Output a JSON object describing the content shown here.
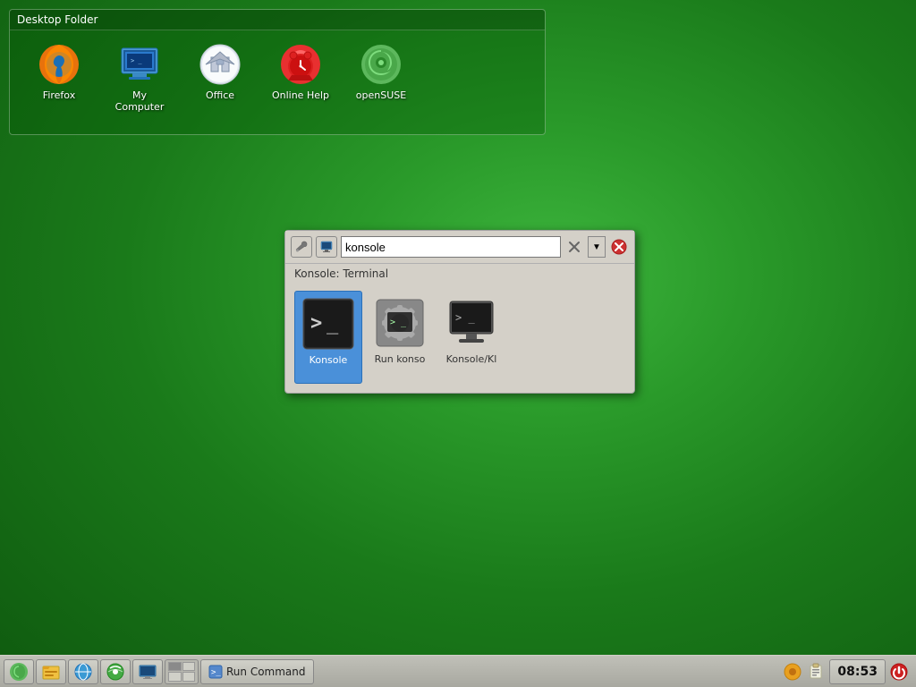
{
  "desktop": {
    "title": "Desktop Folder",
    "background_color": "#1a7a1a",
    "icons": [
      {
        "id": "firefox",
        "label": "Firefox",
        "type": "firefox"
      },
      {
        "id": "mycomputer",
        "label": "My Computer",
        "type": "mycomputer"
      },
      {
        "id": "office",
        "label": "Office",
        "type": "office"
      },
      {
        "id": "onlinehelp",
        "label": "Online Help",
        "type": "onlinehelp"
      },
      {
        "id": "opensuse",
        "label": "openSUSE",
        "type": "opensuse"
      }
    ]
  },
  "run_dialog": {
    "search_value": "konsole",
    "search_placeholder": "konsole",
    "result_label": "Konsole: Terminal",
    "results": [
      {
        "id": "konsole",
        "label": "Konsole",
        "type": "terminal",
        "selected": true
      },
      {
        "id": "runkonso",
        "label": "Run konso",
        "type": "runkonso",
        "selected": false
      },
      {
        "id": "konsolekde",
        "label": "Konsole/Kl",
        "type": "konsolekde",
        "selected": false
      }
    ]
  },
  "taskbar": {
    "run_command_label": "Run Command",
    "clock": "08:53",
    "items": []
  }
}
